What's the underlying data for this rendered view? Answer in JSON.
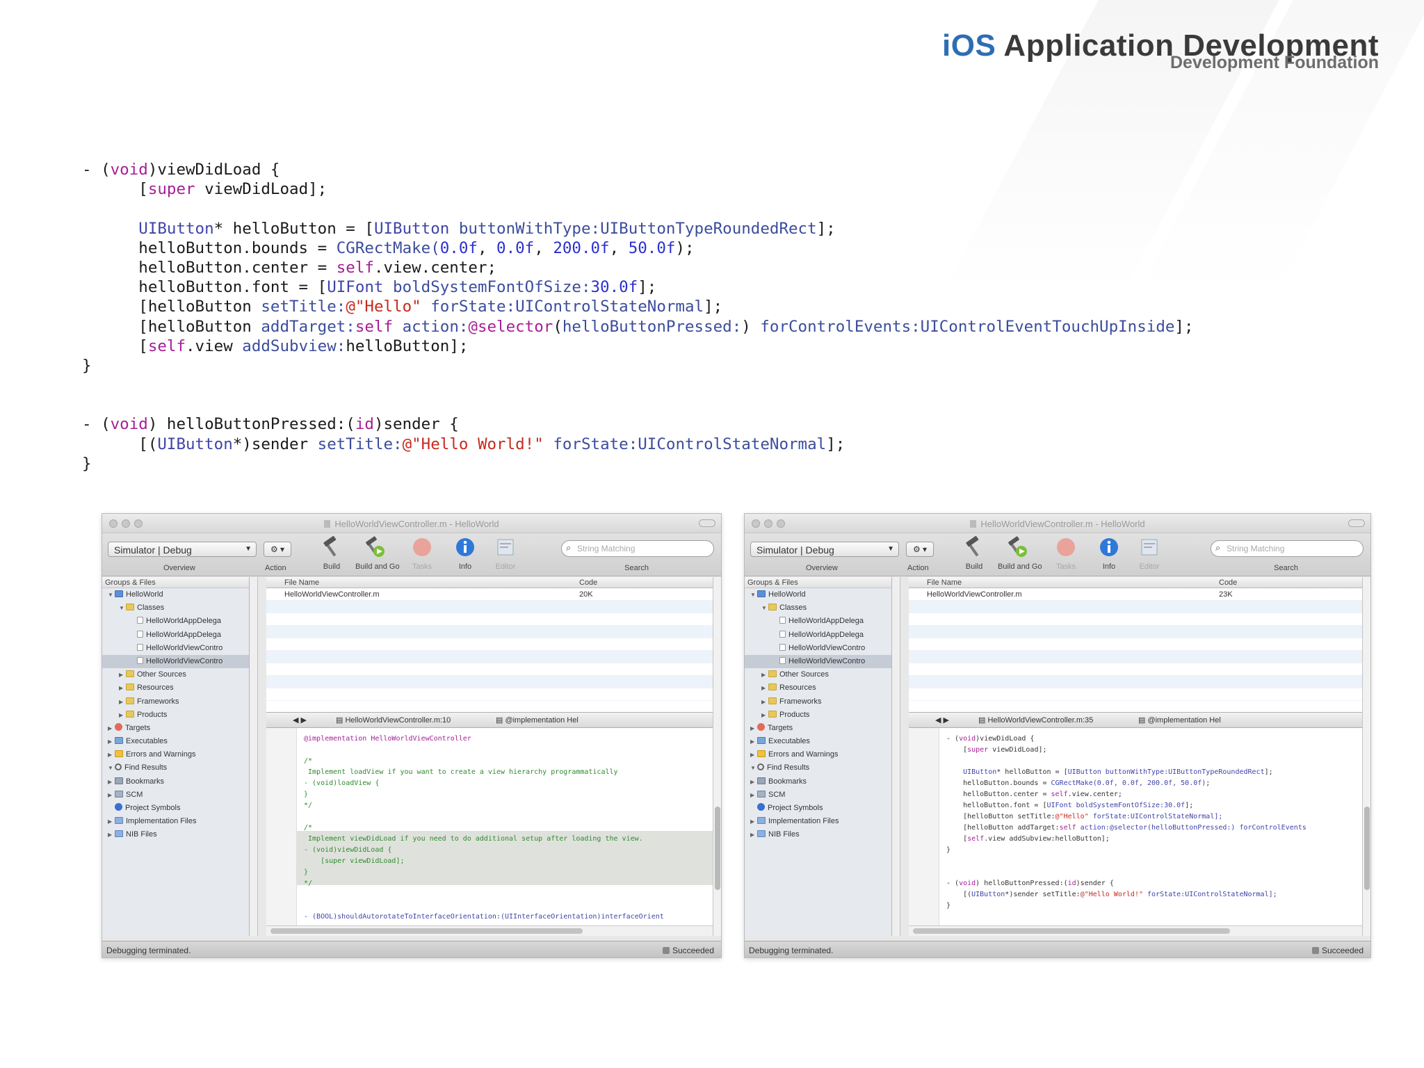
{
  "header": {
    "title_ios": "iOS",
    "title_rest": " Application Development",
    "subtitle": "Development Foundation"
  },
  "code_lines": [
    [
      {
        "t": "- (",
        "c": ""
      },
      {
        "t": "void",
        "c": "kw"
      },
      {
        "t": ")viewDidLoad {",
        "c": ""
      }
    ],
    [
      {
        "t": "      [",
        "c": ""
      },
      {
        "t": "super",
        "c": "kw"
      },
      {
        "t": " viewDidLoad];",
        "c": ""
      }
    ],
    [],
    [
      {
        "t": "      ",
        "c": ""
      },
      {
        "t": "UIButton",
        "c": "ty"
      },
      {
        "t": "* helloButton = [",
        "c": ""
      },
      {
        "t": "UIButton",
        "c": "ty"
      },
      {
        "t": " ",
        "c": ""
      },
      {
        "t": "buttonWithType:UIButtonTypeRoundedRect",
        "c": "mt"
      },
      {
        "t": "];",
        "c": ""
      }
    ],
    [
      {
        "t": "      helloButton.bounds = ",
        "c": ""
      },
      {
        "t": "CGRectMake(",
        "c": "mt"
      },
      {
        "t": "0.0f",
        "c": "nm"
      },
      {
        "t": ", ",
        "c": ""
      },
      {
        "t": "0.0f",
        "c": "nm"
      },
      {
        "t": ", ",
        "c": ""
      },
      {
        "t": "200.0f",
        "c": "nm"
      },
      {
        "t": ", ",
        "c": ""
      },
      {
        "t": "50.0f",
        "c": "nm"
      },
      {
        "t": ");",
        "c": ""
      }
    ],
    [
      {
        "t": "      helloButton.center = ",
        "c": ""
      },
      {
        "t": "self",
        "c": "kw"
      },
      {
        "t": ".view.center;",
        "c": ""
      }
    ],
    [
      {
        "t": "      helloButton.font = [",
        "c": ""
      },
      {
        "t": "UIFont",
        "c": "ty"
      },
      {
        "t": " ",
        "c": ""
      },
      {
        "t": "boldSystemFontOfSize:",
        "c": "mt"
      },
      {
        "t": "30.0f",
        "c": "nm"
      },
      {
        "t": "];",
        "c": ""
      }
    ],
    [
      {
        "t": "      [helloButton ",
        "c": ""
      },
      {
        "t": "setTitle:",
        "c": "mt"
      },
      {
        "t": "@\"Hello\"",
        "c": "st"
      },
      {
        "t": " ",
        "c": ""
      },
      {
        "t": "forState:UIControlStateNormal",
        "c": "mt"
      },
      {
        "t": "];",
        "c": ""
      }
    ],
    [
      {
        "t": "      [helloButton ",
        "c": ""
      },
      {
        "t": "addTarget:",
        "c": "mt"
      },
      {
        "t": "self",
        "c": "kw"
      },
      {
        "t": " ",
        "c": ""
      },
      {
        "t": "action:",
        "c": "mt"
      },
      {
        "t": "@selector",
        "c": "kw"
      },
      {
        "t": "(",
        "c": ""
      },
      {
        "t": "helloButtonPressed:",
        "c": "mt"
      },
      {
        "t": ") ",
        "c": ""
      },
      {
        "t": "forControlEvents:UIControlEventTouchUpInside",
        "c": "mt"
      },
      {
        "t": "];",
        "c": ""
      }
    ],
    [
      {
        "t": "      [",
        "c": ""
      },
      {
        "t": "self",
        "c": "kw"
      },
      {
        "t": ".view ",
        "c": ""
      },
      {
        "t": "addSubview:",
        "c": "mt"
      },
      {
        "t": "helloButton];",
        "c": ""
      }
    ],
    [
      {
        "t": "}",
        "c": ""
      }
    ],
    [],
    [],
    [
      {
        "t": "- (",
        "c": ""
      },
      {
        "t": "void",
        "c": "kw"
      },
      {
        "t": ") helloButtonPressed:(",
        "c": ""
      },
      {
        "t": "id",
        "c": "kw"
      },
      {
        "t": ")sender {",
        "c": ""
      }
    ],
    [
      {
        "t": "      [(",
        "c": ""
      },
      {
        "t": "UIButton",
        "c": "ty"
      },
      {
        "t": "*)sender ",
        "c": ""
      },
      {
        "t": "setTitle:",
        "c": "mt"
      },
      {
        "t": "@\"Hello World!\"",
        "c": "st"
      },
      {
        "t": " ",
        "c": ""
      },
      {
        "t": "forState:UIControlStateNormal",
        "c": "mt"
      },
      {
        "t": "];",
        "c": ""
      }
    ],
    [
      {
        "t": "}",
        "c": ""
      }
    ]
  ],
  "windows": [
    {
      "title": "HelloWorldViewController.m - HelloWorld",
      "scheme": "Simulator | Debug",
      "action_label": "Action",
      "overview_label": "Overview",
      "search_label": "Search",
      "search_placeholder": "String Matching",
      "buttons": [
        {
          "label": "Build",
          "icon": "hammer-icon"
        },
        {
          "label": "Build and Go",
          "icon": "build-and-go-icon"
        },
        {
          "label": "Tasks",
          "icon": "stop-icon"
        },
        {
          "label": "Info",
          "icon": "info-icon"
        },
        {
          "label": "Editor",
          "icon": "editor-icon"
        }
      ],
      "sidebar_header": "Groups & Files",
      "tree": [
        {
          "label": "HelloWorld",
          "indent": 0,
          "icon": "proj",
          "tri": "▼"
        },
        {
          "label": "Classes",
          "indent": 1,
          "icon": "folder",
          "tri": "▼"
        },
        {
          "label": "HelloWorldAppDelega",
          "indent": 2,
          "icon": "file",
          "tri": ""
        },
        {
          "label": "HelloWorldAppDelega",
          "indent": 2,
          "icon": "file",
          "tri": ""
        },
        {
          "label": "HelloWorldViewContro",
          "indent": 2,
          "icon": "file",
          "tri": ""
        },
        {
          "label": "HelloWorldViewContro",
          "indent": 2,
          "icon": "file",
          "tri": "",
          "selected": true
        },
        {
          "label": "Other Sources",
          "indent": 1,
          "icon": "folder",
          "tri": "▶"
        },
        {
          "label": "Resources",
          "indent": 1,
          "icon": "folder",
          "tri": "▶"
        },
        {
          "label": "Frameworks",
          "indent": 1,
          "icon": "folder",
          "tri": "▶"
        },
        {
          "label": "Products",
          "indent": 1,
          "icon": "folder",
          "tri": "▶"
        },
        {
          "label": "Targets",
          "indent": 0,
          "icon": "target",
          "tri": "▶"
        },
        {
          "label": "Executables",
          "indent": 0,
          "icon": "exec",
          "tri": "▶"
        },
        {
          "label": "Errors and Warnings",
          "indent": 0,
          "icon": "warn",
          "tri": "▶"
        },
        {
          "label": "Find Results",
          "indent": 0,
          "icon": "find",
          "tri": "▼"
        },
        {
          "label": "Bookmarks",
          "indent": 0,
          "icon": "book",
          "tri": "▶"
        },
        {
          "label": "SCM",
          "indent": 0,
          "icon": "scm",
          "tri": "▶"
        },
        {
          "label": "Project Symbols",
          "indent": 0,
          "icon": "sym",
          "tri": ""
        },
        {
          "label": "Implementation Files",
          "indent": 0,
          "icon": "impl",
          "tri": "▶"
        },
        {
          "label": "NIB Files",
          "indent": 0,
          "icon": "nib",
          "tri": "▶"
        }
      ],
      "filelist_headers": {
        "name": "File Name",
        "code": "Code"
      },
      "file_row": {
        "name": "HelloWorldViewController.m",
        "code": "20K"
      },
      "editor_bar": {
        "file": "HelloWorldViewController.m:10",
        "impl": "@implementation Hel"
      },
      "editor_lines": [
        [
          {
            "t": "@implementation HelloWorldViewController",
            "c": "k"
          }
        ],
        [],
        [
          {
            "t": "/*",
            "c": "c"
          }
        ],
        [
          {
            "t": " Implement loadView if you want to create a view hierarchy programmatically",
            "c": "c"
          }
        ],
        [
          {
            "t": "- (void)loadView {",
            "c": "c"
          }
        ],
        [
          {
            "t": "}",
            "c": "c"
          }
        ],
        [
          {
            "t": "*/",
            "c": "c"
          }
        ],
        [],
        [
          {
            "t": "/*",
            "c": "c"
          }
        ],
        [
          {
            "t": " Implement viewDidLoad if you need to do additional setup after loading the view.",
            "c": "c"
          }
        ],
        [
          {
            "t": "- (void)viewDidLoad {",
            "c": "c"
          }
        ],
        [
          {
            "t": "    [super viewDidLoad];",
            "c": "c"
          }
        ],
        [
          {
            "t": "}",
            "c": "c"
          }
        ],
        [
          {
            "t": "*/",
            "c": "c"
          }
        ],
        [],
        [],
        [
          {
            "t": "- (BOOL)shouldAutorotateToInterfaceOrientation:(UIInterfaceOrientation)interfaceOrient",
            "c": "t"
          }
        ]
      ],
      "status_left": "Debugging terminated.",
      "status_right": "Succeeded"
    },
    {
      "title": "HelloWorldViewController.m - HelloWorld",
      "scheme": "Simulator | Debug",
      "action_label": "Action",
      "overview_label": "Overview",
      "search_label": "Search",
      "search_placeholder": "String Matching",
      "buttons": [
        {
          "label": "Build",
          "icon": "hammer-icon"
        },
        {
          "label": "Build and Go",
          "icon": "build-and-go-icon"
        },
        {
          "label": "Tasks",
          "icon": "stop-icon"
        },
        {
          "label": "Info",
          "icon": "info-icon"
        },
        {
          "label": "Editor",
          "icon": "editor-icon"
        }
      ],
      "sidebar_header": "Groups & Files",
      "tree": [
        {
          "label": "HelloWorld",
          "indent": 0,
          "icon": "proj",
          "tri": "▼"
        },
        {
          "label": "Classes",
          "indent": 1,
          "icon": "folder",
          "tri": "▼"
        },
        {
          "label": "HelloWorldAppDelega",
          "indent": 2,
          "icon": "file",
          "tri": ""
        },
        {
          "label": "HelloWorldAppDelega",
          "indent": 2,
          "icon": "file",
          "tri": ""
        },
        {
          "label": "HelloWorldViewContro",
          "indent": 2,
          "icon": "file",
          "tri": ""
        },
        {
          "label": "HelloWorldViewContro",
          "indent": 2,
          "icon": "file",
          "tri": "",
          "selected": true
        },
        {
          "label": "Other Sources",
          "indent": 1,
          "icon": "folder",
          "tri": "▶"
        },
        {
          "label": "Resources",
          "indent": 1,
          "icon": "folder",
          "tri": "▶"
        },
        {
          "label": "Frameworks",
          "indent": 1,
          "icon": "folder",
          "tri": "▶"
        },
        {
          "label": "Products",
          "indent": 1,
          "icon": "folder",
          "tri": "▶"
        },
        {
          "label": "Targets",
          "indent": 0,
          "icon": "target",
          "tri": "▶"
        },
        {
          "label": "Executables",
          "indent": 0,
          "icon": "exec",
          "tri": "▶"
        },
        {
          "label": "Errors and Warnings",
          "indent": 0,
          "icon": "warn",
          "tri": "▶"
        },
        {
          "label": "Find Results",
          "indent": 0,
          "icon": "find",
          "tri": "▼"
        },
        {
          "label": "Bookmarks",
          "indent": 0,
          "icon": "book",
          "tri": "▶"
        },
        {
          "label": "SCM",
          "indent": 0,
          "icon": "scm",
          "tri": "▶"
        },
        {
          "label": "Project Symbols",
          "indent": 0,
          "icon": "sym",
          "tri": ""
        },
        {
          "label": "Implementation Files",
          "indent": 0,
          "icon": "impl",
          "tri": "▶"
        },
        {
          "label": "NIB Files",
          "indent": 0,
          "icon": "nib",
          "tri": "▶"
        }
      ],
      "filelist_headers": {
        "name": "File Name",
        "code": "Code"
      },
      "file_row": {
        "name": "HelloWorldViewController.m",
        "code": "23K"
      },
      "editor_bar": {
        "file": "HelloWorldViewController.m:35",
        "impl": "@implementation Hel"
      },
      "editor_lines": [
        [
          {
            "t": "- (",
            "c": ""
          },
          {
            "t": "void",
            "c": "k"
          },
          {
            "t": ")viewDidLoad {",
            "c": ""
          }
        ],
        [
          {
            "t": "    [",
            "c": ""
          },
          {
            "t": "super",
            "c": "k"
          },
          {
            "t": " viewDidLoad];",
            "c": ""
          }
        ],
        [],
        [
          {
            "t": "    ",
            "c": ""
          },
          {
            "t": "UIButton",
            "c": "t"
          },
          {
            "t": "* helloButton = [",
            "c": ""
          },
          {
            "t": "UIButton buttonWithType:UIButtonTypeRoundedRect",
            "c": "t"
          },
          {
            "t": "];",
            "c": ""
          }
        ],
        [
          {
            "t": "    helloButton.bounds = ",
            "c": ""
          },
          {
            "t": "CGRectMake(0.0f, 0.0f, 200.0f, 50.0f)",
            "c": "t"
          },
          {
            "t": ";",
            "c": ""
          }
        ],
        [
          {
            "t": "    helloButton.center = ",
            "c": ""
          },
          {
            "t": "self",
            "c": "k"
          },
          {
            "t": ".view.center;",
            "c": ""
          }
        ],
        [
          {
            "t": "    helloButton.font = [",
            "c": ""
          },
          {
            "t": "UIFont boldSystemFontOfSize:30.0f",
            "c": "t"
          },
          {
            "t": "];",
            "c": ""
          }
        ],
        [
          {
            "t": "    [helloButton setTitle:",
            "c": ""
          },
          {
            "t": "@\"Hello\"",
            "c": "s"
          },
          {
            "t": " forState:UIControlStateNormal];",
            "c": "t"
          }
        ],
        [
          {
            "t": "    [helloButton addTarget:",
            "c": ""
          },
          {
            "t": "self",
            "c": "k"
          },
          {
            "t": " action:@selector(helloButtonPressed:) forControlEvents",
            "c": "t"
          }
        ],
        [
          {
            "t": "    [",
            "c": ""
          },
          {
            "t": "self",
            "c": "k"
          },
          {
            "t": ".view addSubview:helloButton];",
            "c": ""
          }
        ],
        [
          {
            "t": "}",
            "c": ""
          }
        ],
        [],
        [],
        [
          {
            "t": "- (",
            "c": ""
          },
          {
            "t": "void",
            "c": "k"
          },
          {
            "t": ") helloButtonPressed:(",
            "c": ""
          },
          {
            "t": "id",
            "c": "k"
          },
          {
            "t": ")sender {",
            "c": ""
          }
        ],
        [
          {
            "t": "    [(",
            "c": ""
          },
          {
            "t": "UIButton",
            "c": "t"
          },
          {
            "t": "*)sender setTitle:",
            "c": ""
          },
          {
            "t": "@\"Hello World!\"",
            "c": "s"
          },
          {
            "t": " forState:UIControlStateNormal];",
            "c": "t"
          }
        ],
        [
          {
            "t": "}",
            "c": ""
          }
        ]
      ],
      "status_left": "Debugging terminated.",
      "status_right": "Succeeded"
    }
  ]
}
